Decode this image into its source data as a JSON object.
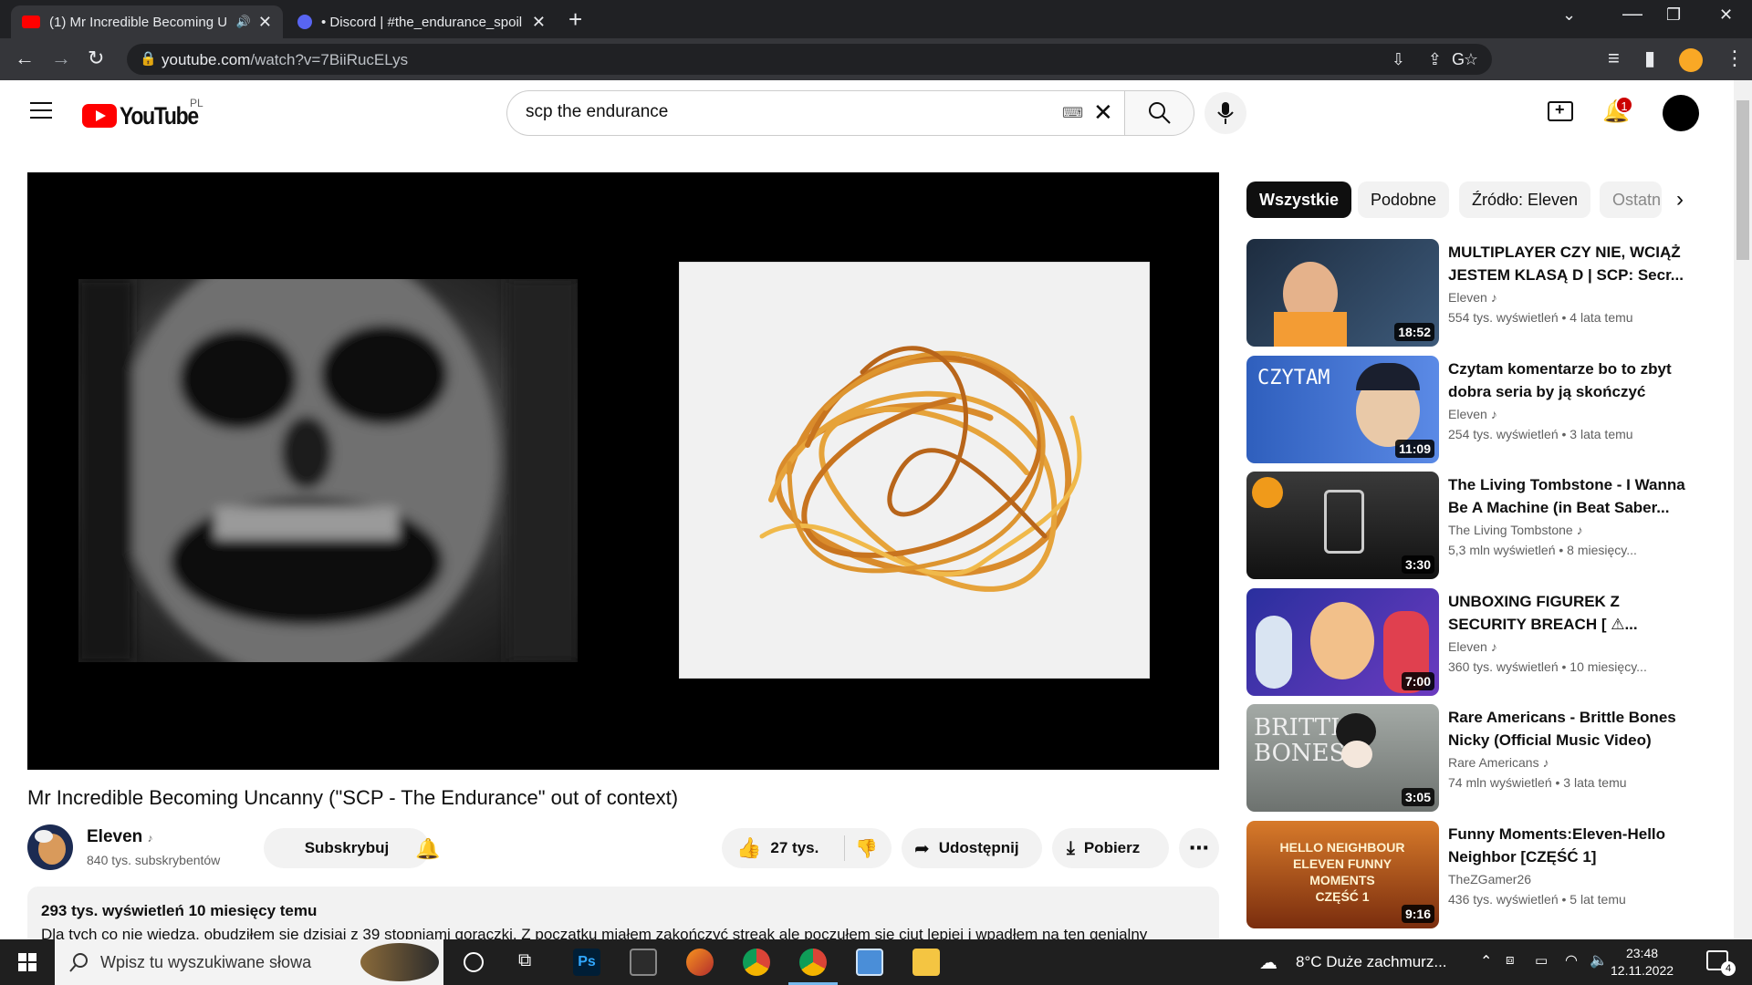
{
  "browser": {
    "tabs": [
      {
        "title": "(1) Mr Incredible Becoming U",
        "active": true
      },
      {
        "title": "• Discord | #the_endurance_spoil",
        "active": false
      }
    ],
    "url_host": "youtube.com",
    "url_path": "/watch?v=7BiiRucELys"
  },
  "youtube": {
    "logo_text": "YouTube",
    "region": "PL",
    "search_value": "scp the endurance",
    "notification_count": "1",
    "video": {
      "title": "Mr Incredible Becoming Uncanny (\"SCP - The Endurance\" out of context)",
      "channel": "Eleven",
      "subscribers": "840 tys. subskrybentów",
      "subscribe_label": "Subskrybuj",
      "likes": "27 tys.",
      "share_label": "Udostępnij",
      "download_label": "Pobierz",
      "views_date": "293 tys. wyświetleń  10 miesięcy temu",
      "description": "Dla tych co nie wiedzą, obudziłem się dzisiaj z 39 stopniami gorączki. Z początku miałem zakończyć streak ale poczułem się ciut lepiej i wpadłem na ten genialny"
    },
    "chips": [
      "Wszystkie",
      "Podobne",
      "Źródło: Eleven",
      "Ostatnio"
    ],
    "recommendations": [
      {
        "title": "MULTIPLAYER CZY NIE, WCIĄŻ JESTEM KLASĄ D | SCP: Secr...",
        "channel": "Eleven",
        "meta": "554 tys. wyświetleń  • 4 lata temu",
        "duration": "18:52",
        "bg": "#1d2c3f",
        "accent": "#f39c34"
      },
      {
        "title": "Czytam komentarze bo to zbyt dobra seria by ją skończyć",
        "channel": "Eleven",
        "meta": "254 tys. wyświetleń  • 3 lata temu",
        "duration": "11:09",
        "bg": "#3b6fd0",
        "accent": "#ffffff"
      },
      {
        "title": "The Living Tombstone - I Wanna Be A Machine (in Beat Saber...",
        "channel": "The Living Tombstone",
        "meta": "5,3 mln wyświetleń  • 8 miesięcy...",
        "duration": "3:30",
        "bg": "#2a2a2a",
        "accent": "#f09a1a"
      },
      {
        "title": "UNBOXING FIGUREK Z SECURITY BREACH [ ⚠...",
        "channel": "Eleven",
        "meta": "360 tys. wyświetleń  • 10 miesięcy...",
        "duration": "7:00",
        "bg": "#2a2f9e",
        "accent": "#e0404f"
      },
      {
        "title": "Rare Americans - Brittle Bones Nicky (Official Music Video)",
        "channel": "Rare Americans",
        "meta": "74 mln wyświetleń  • 3 lata temu",
        "duration": "3:05",
        "bg": "#8a8f8c",
        "accent": "#e7e7e7"
      },
      {
        "title": "Funny Moments:Eleven-Hello Neighbor [CZĘŚĆ 1]",
        "channel": "TheZGamer26",
        "meta": "436 tys. wyświetleń  • 5 lat temu",
        "duration": "9:16",
        "bg": "#b5521b",
        "accent": "#f6c04a"
      }
    ]
  },
  "taskbar": {
    "search_placeholder": "Wpisz tu wyszukiwane słowa",
    "weather": "8°C  Duże zachmurz...",
    "time": "23:48",
    "date": "12.11.2022",
    "notifications": "4"
  }
}
